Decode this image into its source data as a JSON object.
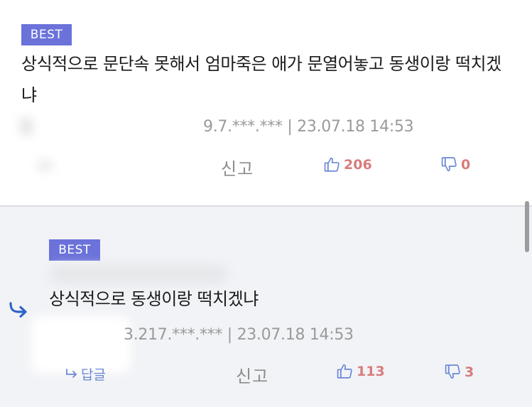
{
  "comments": [
    {
      "badge": "BEST",
      "text": "상식적으로 문단속 못해서 엄마죽은 애가 문열어놓고 동생이랑 떡치겠냐",
      "meta": "9.7.***.*** | 23.07.18 14:53",
      "report_label": "신고",
      "upvotes": "206",
      "downvotes": "0"
    },
    {
      "badge": "BEST",
      "text": "상식적으로 동생이랑 떡치겠냐",
      "meta": "3.217.***.*** | 23.07.18 14:53",
      "report_label": "신고",
      "upvotes": "113",
      "downvotes": "3",
      "reply_label": "답글"
    }
  ],
  "colors": {
    "badge": "#6b72d9",
    "vote_count": "#d77c7c",
    "thumb_icon": "#6b88d6",
    "reply_background": "#f2f3f6"
  },
  "icons": [
    "thumbs-up-icon",
    "thumbs-down-icon",
    "reply-arrow-icon"
  ]
}
